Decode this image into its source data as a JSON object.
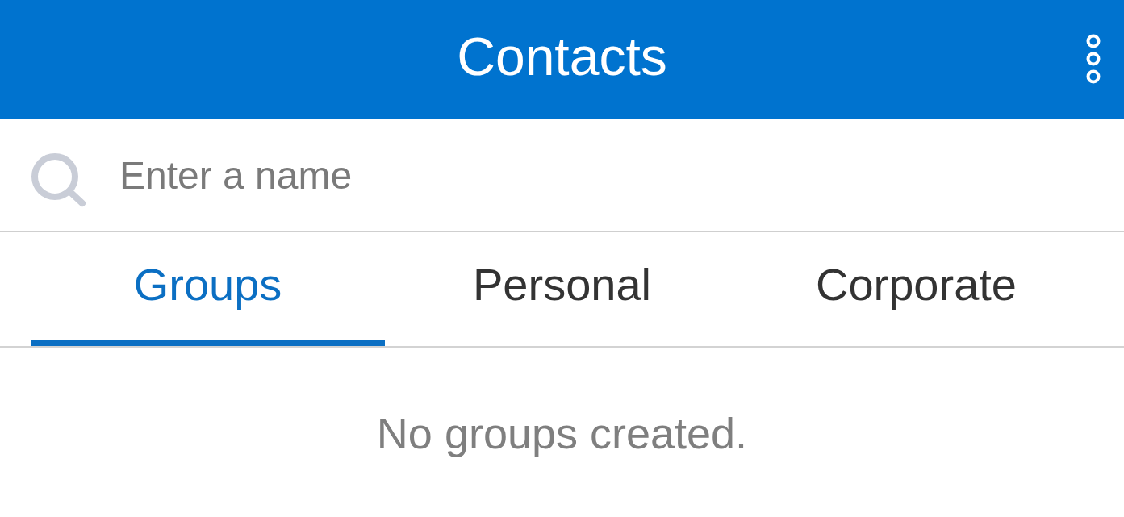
{
  "header": {
    "title": "Contacts"
  },
  "search": {
    "placeholder": "Enter a name"
  },
  "tabs": [
    {
      "label": "Groups",
      "selected": true
    },
    {
      "label": "Personal",
      "selected": false
    },
    {
      "label": "Corporate",
      "selected": false
    }
  ],
  "empty_message": "No groups created."
}
